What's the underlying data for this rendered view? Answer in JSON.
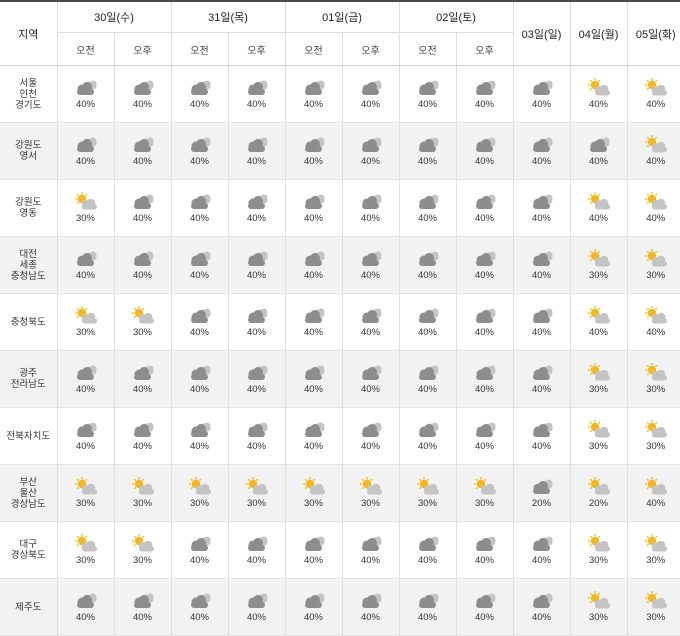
{
  "header": {
    "region_label": "지역",
    "days_split": [
      "30일(수)",
      "31일(목)",
      "01일(금)",
      "02일(토)"
    ],
    "days_single": [
      "03일(일)",
      "04일(월)",
      "05일(화)"
    ],
    "am": "오전",
    "pm": "오후"
  },
  "rows": [
    {
      "region": [
        "서울",
        "인천",
        "경기도"
      ],
      "cells": [
        {
          "icon": "cloudy-icon",
          "pct": "40%"
        },
        {
          "icon": "cloudy-icon",
          "pct": "40%"
        },
        {
          "icon": "cloudy-icon",
          "pct": "40%"
        },
        {
          "icon": "cloudy-icon",
          "pct": "40%"
        },
        {
          "icon": "cloudy-icon",
          "pct": "40%"
        },
        {
          "icon": "cloudy-icon",
          "pct": "40%"
        },
        {
          "icon": "cloudy-icon",
          "pct": "40%"
        },
        {
          "icon": "cloudy-icon",
          "pct": "40%"
        },
        {
          "icon": "cloudy-icon",
          "pct": "40%"
        },
        {
          "icon": "partly-cloudy-icon",
          "pct": "40%"
        },
        {
          "icon": "partly-cloudy-icon",
          "pct": "40%"
        }
      ]
    },
    {
      "region": [
        "강원도",
        "영서"
      ],
      "cells": [
        {
          "icon": "cloudy-icon",
          "pct": "40%"
        },
        {
          "icon": "cloudy-icon",
          "pct": "40%"
        },
        {
          "icon": "cloudy-icon",
          "pct": "40%"
        },
        {
          "icon": "cloudy-icon",
          "pct": "40%"
        },
        {
          "icon": "cloudy-icon",
          "pct": "40%"
        },
        {
          "icon": "cloudy-icon",
          "pct": "40%"
        },
        {
          "icon": "cloudy-icon",
          "pct": "40%"
        },
        {
          "icon": "cloudy-icon",
          "pct": "40%"
        },
        {
          "icon": "cloudy-icon",
          "pct": "40%"
        },
        {
          "icon": "cloudy-icon",
          "pct": "40%"
        },
        {
          "icon": "partly-cloudy-icon",
          "pct": "40%"
        }
      ]
    },
    {
      "region": [
        "강원도",
        "영동"
      ],
      "cells": [
        {
          "icon": "partly-cloudy-icon",
          "pct": "30%"
        },
        {
          "icon": "cloudy-icon",
          "pct": "40%"
        },
        {
          "icon": "cloudy-icon",
          "pct": "40%"
        },
        {
          "icon": "cloudy-icon",
          "pct": "40%"
        },
        {
          "icon": "cloudy-icon",
          "pct": "40%"
        },
        {
          "icon": "cloudy-icon",
          "pct": "40%"
        },
        {
          "icon": "cloudy-icon",
          "pct": "40%"
        },
        {
          "icon": "cloudy-icon",
          "pct": "40%"
        },
        {
          "icon": "cloudy-icon",
          "pct": "40%"
        },
        {
          "icon": "partly-cloudy-icon",
          "pct": "40%"
        },
        {
          "icon": "partly-cloudy-icon",
          "pct": "40%"
        }
      ]
    },
    {
      "region": [
        "대전",
        "세종",
        "충청남도"
      ],
      "cells": [
        {
          "icon": "cloudy-icon",
          "pct": "40%"
        },
        {
          "icon": "cloudy-icon",
          "pct": "40%"
        },
        {
          "icon": "cloudy-icon",
          "pct": "40%"
        },
        {
          "icon": "cloudy-icon",
          "pct": "40%"
        },
        {
          "icon": "cloudy-icon",
          "pct": "40%"
        },
        {
          "icon": "cloudy-icon",
          "pct": "40%"
        },
        {
          "icon": "cloudy-icon",
          "pct": "40%"
        },
        {
          "icon": "cloudy-icon",
          "pct": "40%"
        },
        {
          "icon": "cloudy-icon",
          "pct": "40%"
        },
        {
          "icon": "partly-cloudy-icon",
          "pct": "30%"
        },
        {
          "icon": "partly-cloudy-icon",
          "pct": "30%"
        }
      ]
    },
    {
      "region": [
        "충청북도"
      ],
      "cells": [
        {
          "icon": "partly-cloudy-icon",
          "pct": "30%"
        },
        {
          "icon": "partly-cloudy-icon",
          "pct": "30%"
        },
        {
          "icon": "cloudy-icon",
          "pct": "40%"
        },
        {
          "icon": "cloudy-icon",
          "pct": "40%"
        },
        {
          "icon": "cloudy-icon",
          "pct": "40%"
        },
        {
          "icon": "cloudy-icon",
          "pct": "40%"
        },
        {
          "icon": "cloudy-icon",
          "pct": "40%"
        },
        {
          "icon": "cloudy-icon",
          "pct": "40%"
        },
        {
          "icon": "cloudy-icon",
          "pct": "40%"
        },
        {
          "icon": "partly-cloudy-icon",
          "pct": "40%"
        },
        {
          "icon": "partly-cloudy-icon",
          "pct": "40%"
        }
      ]
    },
    {
      "region": [
        "광주",
        "전라남도"
      ],
      "cells": [
        {
          "icon": "cloudy-icon",
          "pct": "40%"
        },
        {
          "icon": "cloudy-icon",
          "pct": "40%"
        },
        {
          "icon": "cloudy-icon",
          "pct": "40%"
        },
        {
          "icon": "cloudy-icon",
          "pct": "40%"
        },
        {
          "icon": "cloudy-icon",
          "pct": "40%"
        },
        {
          "icon": "cloudy-icon",
          "pct": "40%"
        },
        {
          "icon": "cloudy-icon",
          "pct": "40%"
        },
        {
          "icon": "cloudy-icon",
          "pct": "40%"
        },
        {
          "icon": "cloudy-icon",
          "pct": "40%"
        },
        {
          "icon": "partly-cloudy-icon",
          "pct": "30%"
        },
        {
          "icon": "partly-cloudy-icon",
          "pct": "30%"
        }
      ]
    },
    {
      "region": [
        "전북자치도"
      ],
      "cells": [
        {
          "icon": "cloudy-icon",
          "pct": "40%"
        },
        {
          "icon": "cloudy-icon",
          "pct": "40%"
        },
        {
          "icon": "cloudy-icon",
          "pct": "40%"
        },
        {
          "icon": "cloudy-icon",
          "pct": "40%"
        },
        {
          "icon": "cloudy-icon",
          "pct": "40%"
        },
        {
          "icon": "cloudy-icon",
          "pct": "40%"
        },
        {
          "icon": "cloudy-icon",
          "pct": "40%"
        },
        {
          "icon": "cloudy-icon",
          "pct": "40%"
        },
        {
          "icon": "cloudy-icon",
          "pct": "40%"
        },
        {
          "icon": "partly-cloudy-icon",
          "pct": "30%"
        },
        {
          "icon": "partly-cloudy-icon",
          "pct": "30%"
        }
      ]
    },
    {
      "region": [
        "부산",
        "울산",
        "경상남도"
      ],
      "cells": [
        {
          "icon": "partly-cloudy-icon",
          "pct": "30%"
        },
        {
          "icon": "partly-cloudy-icon",
          "pct": "30%"
        },
        {
          "icon": "partly-cloudy-icon",
          "pct": "30%"
        },
        {
          "icon": "partly-cloudy-icon",
          "pct": "30%"
        },
        {
          "icon": "partly-cloudy-icon",
          "pct": "30%"
        },
        {
          "icon": "partly-cloudy-icon",
          "pct": "30%"
        },
        {
          "icon": "partly-cloudy-icon",
          "pct": "30%"
        },
        {
          "icon": "partly-cloudy-icon",
          "pct": "30%"
        },
        {
          "icon": "cloudy-icon",
          "pct": "20%"
        },
        {
          "icon": "partly-cloudy-icon",
          "pct": "20%"
        },
        {
          "icon": "partly-cloudy-icon",
          "pct": "40%"
        }
      ]
    },
    {
      "region": [
        "대구",
        "경상북도"
      ],
      "cells": [
        {
          "icon": "partly-cloudy-icon",
          "pct": "30%"
        },
        {
          "icon": "partly-cloudy-icon",
          "pct": "30%"
        },
        {
          "icon": "cloudy-icon",
          "pct": "40%"
        },
        {
          "icon": "cloudy-icon",
          "pct": "40%"
        },
        {
          "icon": "cloudy-icon",
          "pct": "40%"
        },
        {
          "icon": "cloudy-icon",
          "pct": "40%"
        },
        {
          "icon": "cloudy-icon",
          "pct": "40%"
        },
        {
          "icon": "cloudy-icon",
          "pct": "40%"
        },
        {
          "icon": "cloudy-icon",
          "pct": "40%"
        },
        {
          "icon": "partly-cloudy-icon",
          "pct": "30%"
        },
        {
          "icon": "partly-cloudy-icon",
          "pct": "30%"
        }
      ]
    },
    {
      "region": [
        "제주도"
      ],
      "cells": [
        {
          "icon": "cloudy-icon",
          "pct": "40%"
        },
        {
          "icon": "cloudy-icon",
          "pct": "40%"
        },
        {
          "icon": "cloudy-icon",
          "pct": "40%"
        },
        {
          "icon": "cloudy-icon",
          "pct": "40%"
        },
        {
          "icon": "cloudy-icon",
          "pct": "40%"
        },
        {
          "icon": "cloudy-icon",
          "pct": "40%"
        },
        {
          "icon": "cloudy-icon",
          "pct": "40%"
        },
        {
          "icon": "cloudy-icon",
          "pct": "40%"
        },
        {
          "icon": "cloudy-icon",
          "pct": "40%"
        },
        {
          "icon": "partly-cloudy-icon",
          "pct": "30%"
        },
        {
          "icon": "partly-cloudy-icon",
          "pct": "30%"
        }
      ]
    }
  ],
  "colors": {
    "header_border": "#4a4a4a",
    "stripe": "#f2f2f2",
    "cloud_dark": "#8d8d8d",
    "cloud_light": "#c4c4c4",
    "sun": "#f5b81c"
  }
}
